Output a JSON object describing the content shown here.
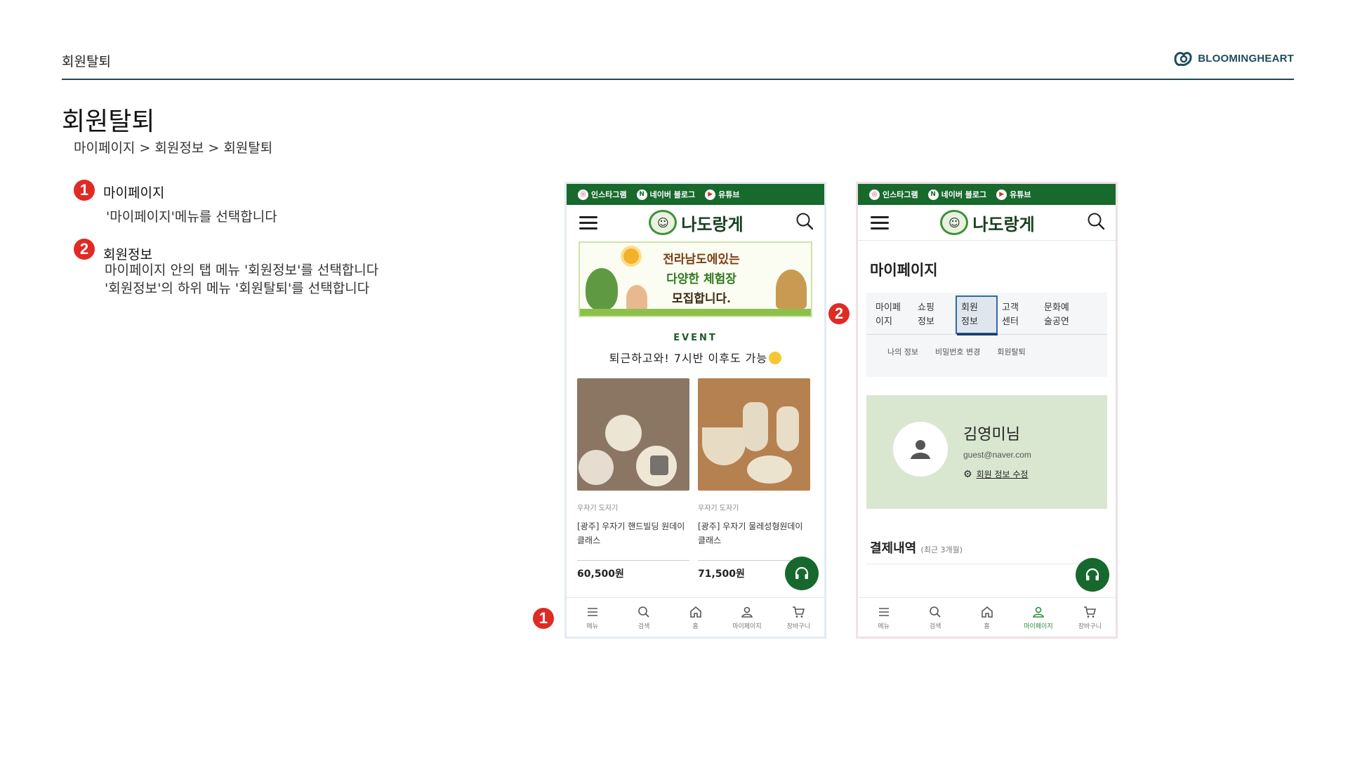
{
  "header": {
    "section_label": "회원탈퇴",
    "brand_name": "BLOOMINGHEART",
    "brand_color": "#1e4d5c"
  },
  "page": {
    "title": "회원탈퇴",
    "breadcrumb": "마이페이지 > 회원정보 > 회원탈퇴"
  },
  "steps": [
    {
      "number": "1",
      "title": "마이페이지",
      "desc_lines": [
        "'마이페이지'메뉴를 선택합니다"
      ]
    },
    {
      "number": "2",
      "title": "회원정보",
      "desc_lines": [
        "마이페이지 안의 탭 메뉴 '회원정보'를 선택합니다",
        "'회원정보'의 하위 메뉴 '회원탈퇴'를 선택합니다"
      ]
    }
  ],
  "markers": {
    "m1": "1",
    "m2": "2",
    "color": "#e02a24"
  },
  "app": {
    "social": [
      {
        "label": "인스타그램",
        "icon": "instagram-icon"
      },
      {
        "label": "네이버 블로그",
        "icon": "naver-blog-icon"
      },
      {
        "label": "유튜브",
        "icon": "youtube-icon"
      }
    ],
    "logo_text": "나도랑게",
    "brand_green": "#18692c",
    "bottom_nav": [
      {
        "label": "메뉴",
        "icon": "menu-icon"
      },
      {
        "label": "검색",
        "icon": "search-icon"
      },
      {
        "label": "홈",
        "icon": "home-icon"
      },
      {
        "label": "마이페이지",
        "icon": "user-icon"
      },
      {
        "label": "장바구니",
        "icon": "cart-icon"
      }
    ]
  },
  "home_screen": {
    "banner_lines": [
      "전라남도에있는",
      "다양한 체험장",
      "모집합니다."
    ],
    "event_label": "EVENT",
    "event_title": "퇴근하고와! 7시반 이후도 가능",
    "products": [
      {
        "category": "우자기 도자기",
        "name": "[광주] 우자기 핸드빌딩 원데이클래스",
        "price": "60,500원"
      },
      {
        "category": "우자기 도자기",
        "name": "[광주] 우자기 물레성형원데이클래스",
        "price": "71,500원"
      }
    ]
  },
  "mypage_screen": {
    "title": "마이페이지",
    "tabs": [
      "마이페\n이지",
      "쇼핑\n정보",
      "회원\n정보",
      "고객\n센터",
      "문화예\n술공연"
    ],
    "active_tab": 2,
    "subtabs": [
      "나의 정보",
      "비밀번호 변경",
      "회원탈퇴"
    ],
    "profile": {
      "name": "김영미님",
      "email": "guest@naver.com",
      "edit_label": "회원 정보 수정"
    },
    "payment_title": "결제내역",
    "payment_sub": "(최근 3개월)",
    "active_nav": 3
  }
}
